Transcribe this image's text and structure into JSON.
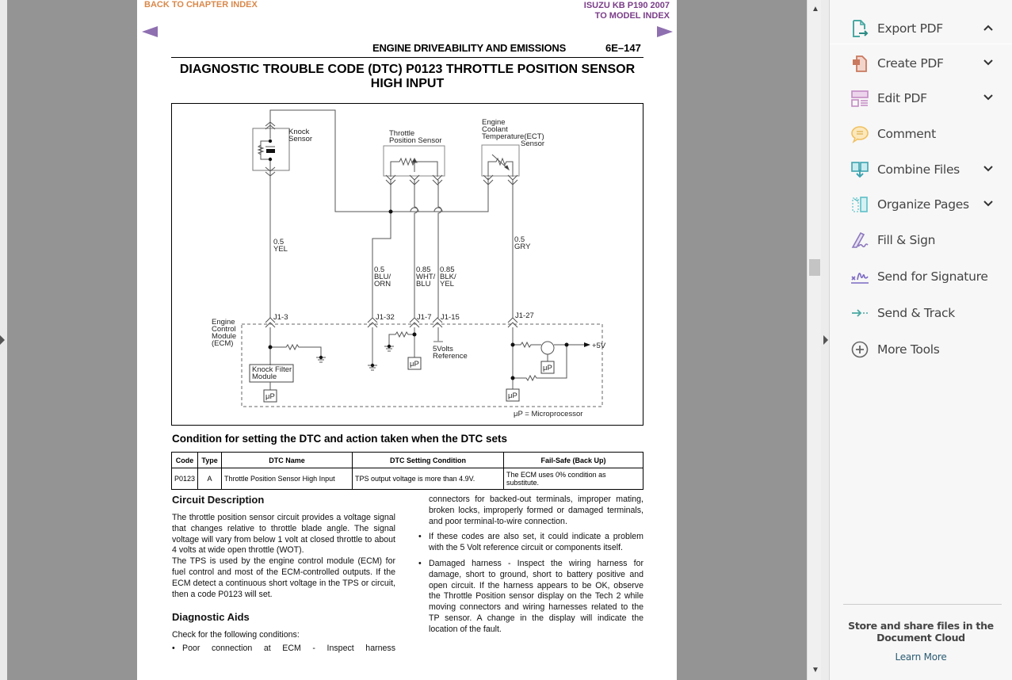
{
  "page": {
    "back_link": "BACK TO CHAPTER INDEX",
    "model": "ISUZU KB P190 2007",
    "model_link": "TO MODEL INDEX",
    "running_head": "ENGINE DRIVEABILITY AND EMISSIONS",
    "page_number": "6E–147",
    "title_line1": "DIAGNOSTIC TROUBLE CODE (DTC) P0123 THROTTLE POSITION SENSOR",
    "title_line2": "HIGH INPUT"
  },
  "diagram": {
    "knock_sensor": [
      "Knock",
      "Sensor"
    ],
    "tps": [
      "Throttle",
      "Position Sensor"
    ],
    "ect": [
      "Engine",
      "Coolant",
      "Temperature(ECT)",
      "Sensor"
    ],
    "wires": {
      "yel": [
        "0.5",
        "YEL"
      ],
      "blu_orn": [
        "0.5",
        "BLU/",
        "ORN"
      ],
      "wht_blu": [
        "0.85",
        "WHT/",
        "BLU"
      ],
      "blk_yel": [
        "0.85",
        "BLK/",
        "YEL"
      ],
      "gry": [
        "0.5",
        "GRY"
      ]
    },
    "pins": [
      "J1-3",
      "J1-32",
      "J1-7",
      "J1-15",
      "J1-27"
    ],
    "ecm": [
      "Engine",
      "Control",
      "Module",
      "(ECM)"
    ],
    "knock_filter": [
      "Knock Filter",
      "Module"
    ],
    "micro": "μP",
    "five_volt_ref": [
      "5Volts",
      "Reference"
    ],
    "plus5v": "+5V",
    "legend": "μP = Microprocessor"
  },
  "conditions": {
    "heading": "Condition for setting the DTC and action taken when the DTC sets",
    "columns": [
      "Code",
      "Type",
      "DTC Name",
      "DTC Setting Condition",
      "Fail-Safe (Back Up)"
    ],
    "rows": [
      [
        "P0123",
        "A",
        "Throttle Position Sensor High Input",
        "TPS output voltage is more than 4.9V.",
        "The ECM uses 0% condition as substitute."
      ]
    ]
  },
  "circuit_description": {
    "heading": "Circuit Description",
    "p1": "The throttle position sensor circuit provides a voltage signal that changes relative to throttle blade angle. The signal voltage will vary from below 1 volt at closed throttle to about 4 volts at wide open throttle (WOT).",
    "p2": "The TPS is used by the engine control module (ECM) for fuel control and most of the ECM-controlled outputs. If the ECM detect a continuous short voltage in the TPS or circuit, then a code P0123 will set."
  },
  "diagnostic_aids": {
    "heading": "Diagnostic Aids",
    "intro": "Check for the following conditions:",
    "bullet1_start": "Poor connection at ECM - Inspect harness",
    "bullet1_cont": "connectors for backed-out terminals, improper mating, broken locks, improperly formed or damaged terminals, and poor terminal-to-wire connection.",
    "bullet2": "If these codes are also set, it could indicate a problem with the 5 Volt reference circuit or components itself.",
    "bullet3": "Damaged harness - Inspect the wiring harness for damage, short to ground, short to battery positive and open circuit. If the harness appears to be OK, observe the Throttle Position sensor display on the Tech 2 while moving connectors and wiring harnesses related to the TP sensor. A change in the display will indicate the location of the fault."
  },
  "tools_pane": {
    "items": [
      {
        "label": "Export PDF",
        "icon": "export-pdf-icon",
        "chevron": "up"
      },
      {
        "label": "Create PDF",
        "icon": "create-pdf-icon",
        "chevron": "down"
      },
      {
        "label": "Edit PDF",
        "icon": "edit-pdf-icon",
        "chevron": "down"
      },
      {
        "label": "Comment",
        "icon": "comment-icon",
        "chevron": ""
      },
      {
        "label": "Combine Files",
        "icon": "combine-files-icon",
        "chevron": "down"
      },
      {
        "label": "Organize Pages",
        "icon": "organize-pages-icon",
        "chevron": "down"
      },
      {
        "label": "Fill & Sign",
        "icon": "fill-sign-icon",
        "chevron": ""
      },
      {
        "label": "Send for Signature",
        "icon": "send-signature-icon",
        "chevron": ""
      },
      {
        "label": "Send & Track",
        "icon": "send-track-icon",
        "chevron": ""
      },
      {
        "label": "More Tools",
        "icon": "more-tools-icon",
        "chevron": ""
      }
    ],
    "cloud_text": "Store and share files in the Document Cloud",
    "learn_more": "Learn More"
  },
  "colors": {
    "back_link": "#d9884a",
    "model_link": "#7a3d88",
    "nav_arrow": "#8e6fb0",
    "learn_more": "#2a5b73"
  }
}
